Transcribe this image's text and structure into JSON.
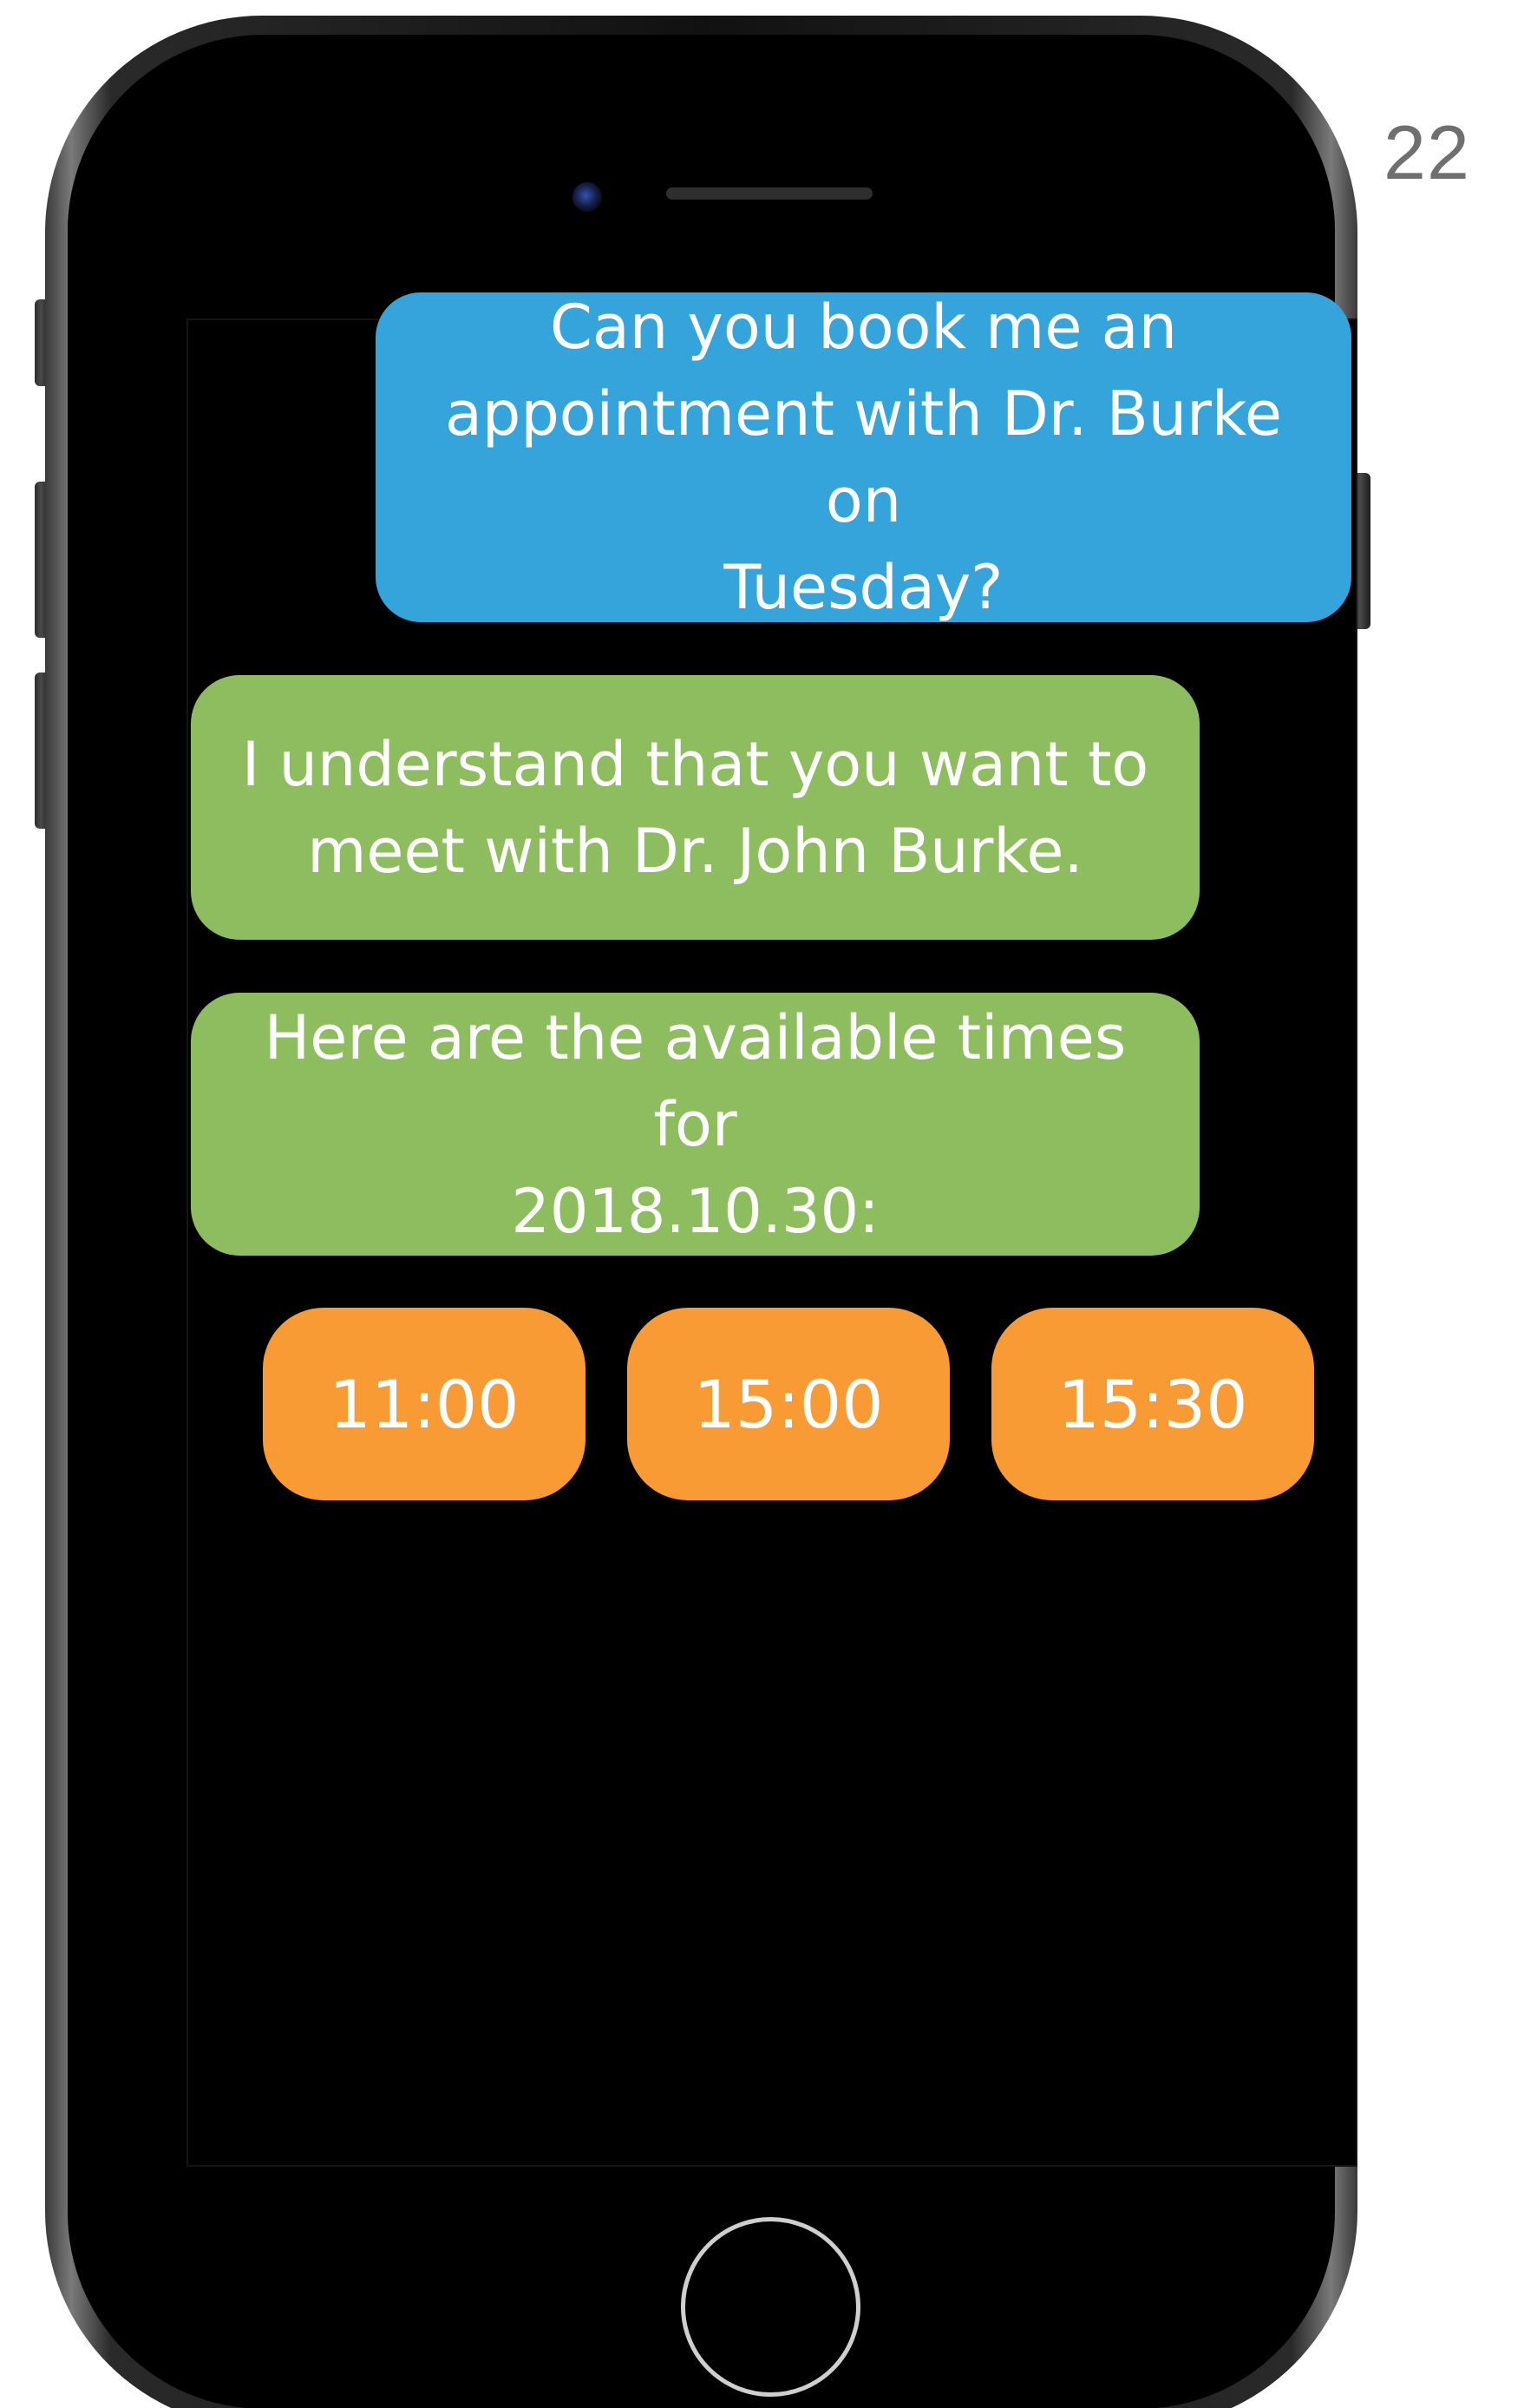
{
  "page": {
    "number": "22"
  },
  "colors": {
    "user_bubble": "#34a4db",
    "bot_bubble": "#8dbd5e",
    "time_slot": "#f99b35",
    "screen_background": "#000000"
  },
  "chat": {
    "messages": [
      {
        "sender": "user",
        "text": "Can you book me an\nappointment with Dr. Burke on\nTuesday?"
      },
      {
        "sender": "bot",
        "text": "I understand that you want to\nmeet with Dr. John Burke."
      },
      {
        "sender": "bot",
        "text": "Here are the available times for\n2018.10.30:"
      }
    ],
    "time_slots": [
      "11:00",
      "15:00",
      "15:30"
    ]
  }
}
